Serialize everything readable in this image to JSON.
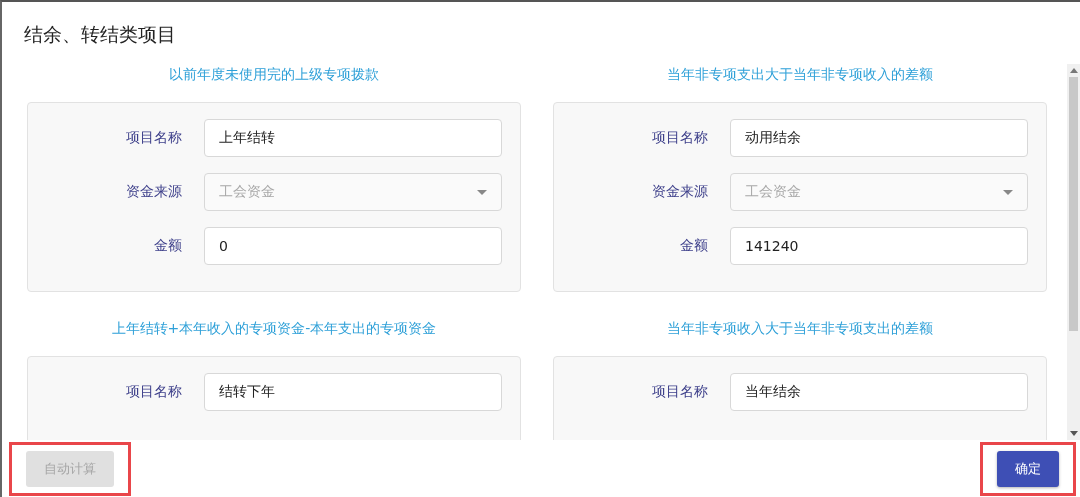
{
  "dialog": {
    "title": "结余、转结类项目"
  },
  "sections": [
    {
      "heading": "以前年度未使用完的上级专项拨款",
      "fields": [
        {
          "label": "项目名称",
          "kind": "text",
          "value": "上年结转",
          "disabled": false
        },
        {
          "label": "资金来源",
          "kind": "select",
          "value": "工会资金",
          "disabled": true
        },
        {
          "label": "金额",
          "kind": "text",
          "value": "0",
          "disabled": false
        }
      ]
    },
    {
      "heading": "当年非专项支出大于当年非专项收入的差额",
      "fields": [
        {
          "label": "项目名称",
          "kind": "text",
          "value": "动用结余",
          "disabled": false
        },
        {
          "label": "资金来源",
          "kind": "select",
          "value": "工会资金",
          "disabled": true
        },
        {
          "label": "金额",
          "kind": "text",
          "value": "141240",
          "disabled": false
        }
      ]
    },
    {
      "heading": "上年结转+本年收入的专项资金-本年支出的专项资金",
      "fields": [
        {
          "label": "项目名称",
          "kind": "text",
          "value": "结转下年",
          "disabled": false
        }
      ]
    },
    {
      "heading": "当年非专项收入大于当年非专项支出的差额",
      "fields": [
        {
          "label": "项目名称",
          "kind": "text",
          "value": "当年结余",
          "disabled": false
        }
      ]
    }
  ],
  "footer": {
    "buttons": [
      {
        "label": "自动计算",
        "kind": "secondary",
        "disabled": true,
        "highlighted": true
      },
      {
        "label": "确定",
        "kind": "primary",
        "disabled": false,
        "highlighted": true
      }
    ]
  }
}
